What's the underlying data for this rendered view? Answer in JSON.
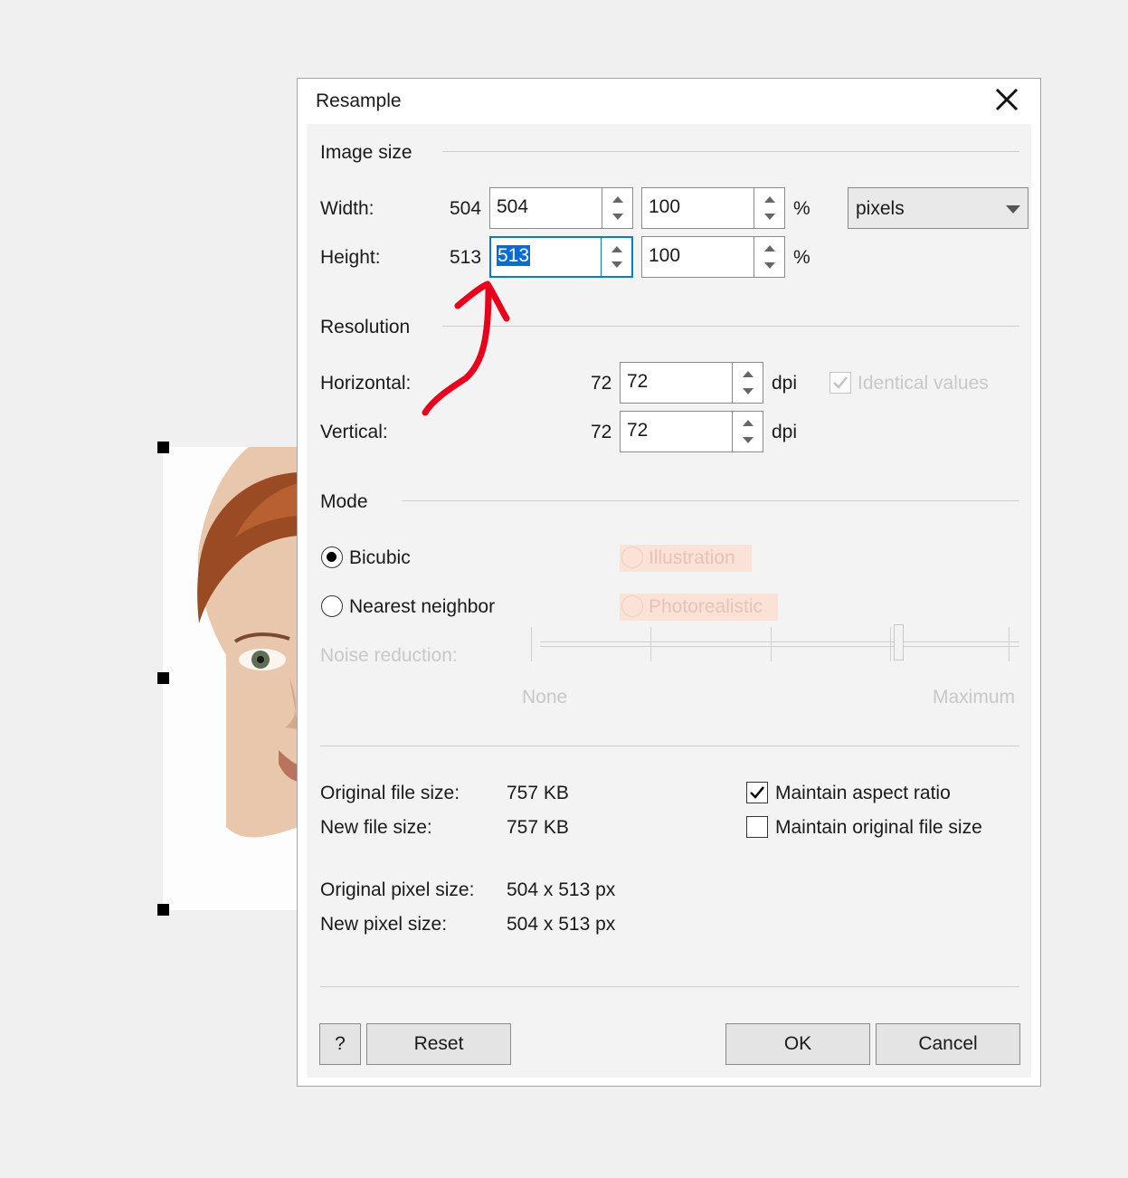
{
  "dialog": {
    "title": "Resample",
    "sections": {
      "image_size": "Image size",
      "resolution": "Resolution",
      "mode": "Mode"
    },
    "image_size": {
      "width_label": "Width:",
      "width_original": "504",
      "width_value": "504",
      "width_percent": "100",
      "height_label": "Height:",
      "height_original": "513",
      "height_value": "513",
      "height_percent": "100",
      "percent_sign": "%",
      "unit_selected": "pixels"
    },
    "resolution": {
      "horizontal_label": "Horizontal:",
      "horizontal_original": "72",
      "horizontal_value": "72",
      "vertical_label": "Vertical:",
      "vertical_original": "72",
      "vertical_value": "72",
      "unit": "dpi",
      "identical_values": "Identical values"
    },
    "mode": {
      "bicubic": "Bicubic",
      "nearest_neighbor": "Nearest neighbor",
      "illustration": "Illustration",
      "photorealistic": "Photorealistic",
      "noise_reduction": "Noise reduction:",
      "slider_min": "None",
      "slider_max": "Maximum",
      "slider_level": 0.75
    },
    "info": {
      "original_file_size_label": "Original file size:",
      "original_file_size": "757 KB",
      "new_file_size_label": "New file size:",
      "new_file_size": "757 KB",
      "original_pixel_size_label": "Original pixel size:",
      "original_pixel_size": "504 x 513 px",
      "new_pixel_size_label": "New pixel size:",
      "new_pixel_size": "504 x 513 px",
      "maintain_aspect_ratio": "Maintain aspect ratio",
      "maintain_original_file_size": "Maintain original file size"
    },
    "buttons": {
      "help": "?",
      "reset": "Reset",
      "ok": "OK",
      "cancel": "Cancel"
    }
  },
  "colors": {
    "focus_border": "#0a78d7",
    "selection": "#0a6cd0",
    "annotation_arrow": "#e8001c"
  }
}
